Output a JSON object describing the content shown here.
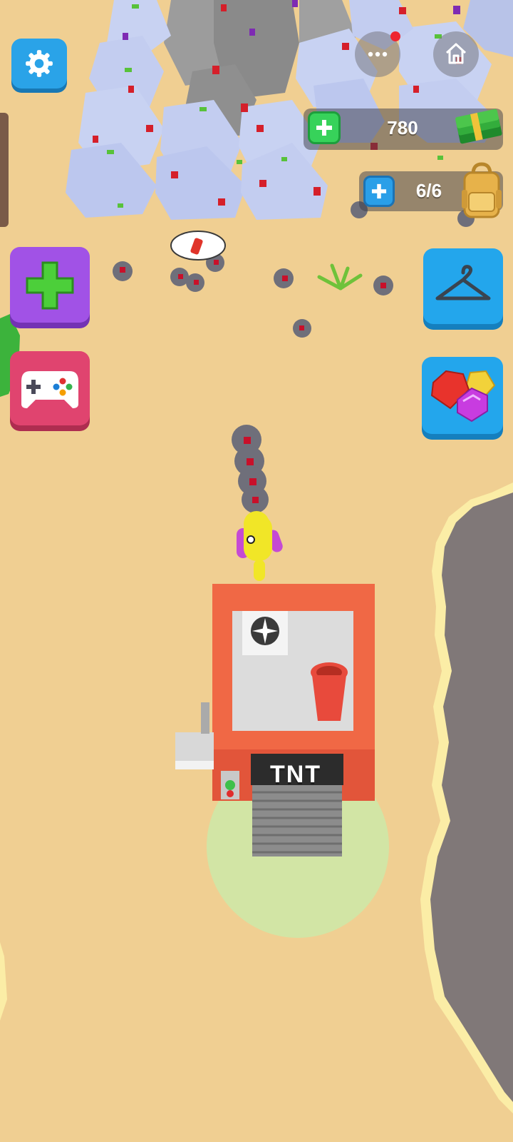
{
  "hud": {
    "cash_value": "780",
    "backpack_capacity": "6/6",
    "building_sign": "TNT"
  },
  "icons": {
    "settings": "gear-icon",
    "more": "more-dots-icon",
    "home": "home-icon",
    "cash_plus": "plus-icon",
    "cash": "cash-stack-icon",
    "bag_plus": "plus-icon",
    "bag": "backpack-icon",
    "add_worker": "plus-icon",
    "games": "gamepad-icon",
    "skins": "hanger-icon",
    "gems": "gems-icon"
  },
  "colors": {
    "sand": "#f0cf92",
    "settings_blue": "#2aa3e8",
    "purple_button": "#a152e6",
    "pink_button": "#e0446f",
    "blue_button": "#23a6ec",
    "cash_green": "#37d25a",
    "building_red": "#f06845",
    "notification_red": "#ee2430"
  }
}
